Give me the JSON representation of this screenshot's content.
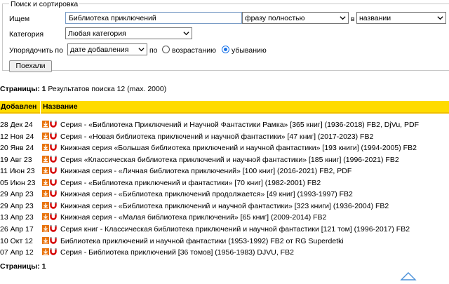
{
  "search": {
    "legend": "Поиск и сортировка",
    "query_label": "Ищем",
    "query_value": "Библиотека приключений",
    "match_mode": "фразу полностью",
    "in_label": "в",
    "field": "названии",
    "category_label": "Категория",
    "category_value": "Любая категория",
    "sort_label": "Упорядочить по",
    "sort_value": "дате добавления",
    "by_label": "по",
    "asc_label": "возрастанию",
    "desc_label": "убыванию",
    "order_selected": "desc",
    "submit_label": "Поехали"
  },
  "pages_top": {
    "label": "Страницы:",
    "num": "1",
    "results": "Результатов поиска 12 (max. 2000)"
  },
  "table": {
    "col_added": "Добавлен",
    "col_name": "Название",
    "rows": [
      {
        "date": "28 Дек 24",
        "title": "Серия - «Библиотека Приключений и Научной Фантастики Рамка» [365 книг] (1936-2018) FB2, DjVu, PDF"
      },
      {
        "date": "12 Ноя 24",
        "title": "Серия - «Новая библиотека приключений и научной фантастики» [47 книг] (2017-2023) FB2"
      },
      {
        "date": "20 Янв 24",
        "title": "Книжная серия «Большая библиотека приключений и научной фантастики» [193 книги] (1994-2005) FB2"
      },
      {
        "date": "19 Авг 23",
        "title": "Серия «Классическая библиотека приключений и научной фантастики» [185 книг] (1996-2021) FB2"
      },
      {
        "date": "11 Июн 23",
        "title": "Книжная серия - «Личная библиотека приключений» [100 книг] (2016-2021) FB2, PDF"
      },
      {
        "date": "05 Июн 23",
        "title": "Серия - «Библиотека приключений и фантастики» [70 книг] (1982-2001) FB2"
      },
      {
        "date": "29 Апр 23",
        "title": "Книжная серия - «Библиотека приключений продолжается» [49 книг] (1993-1997) FB2"
      },
      {
        "date": "29 Апр 23",
        "title": "Книжная серия - «Библиотека приключений и научной фантастики» [323 книги] (1936-2004) FB2"
      },
      {
        "date": "13 Апр 23",
        "title": "Книжная серия - «Малая библиотека приключений» [65 книг] (2009-2014) FB2"
      },
      {
        "date": "26 Апр 17",
        "title": "Серия книг - Классическая библиотека приключений и научной фантастики [121 том] (1996-2017) FB2"
      },
      {
        "date": "10 Окт 12",
        "title": "Библиотека приключений и научной фантастики (1953-1992) FB2 от RG Superdetki"
      },
      {
        "date": "07 Апр 12",
        "title": "Серия - Библиотека приключений [36 томов] (1956-1983) DJVU, FB2"
      }
    ]
  },
  "pages_bottom": {
    "label": "Страницы:",
    "num": "1"
  },
  "icons": {
    "download": "download-icon",
    "magnet": "magnet-icon",
    "scroll_top": "scroll-top-icon"
  },
  "colors": {
    "header_bg": "#ffdb00",
    "download_icon": "#e8730c",
    "magnet_icon": "#d40000",
    "scroll_arrow": "#4a90d9"
  }
}
